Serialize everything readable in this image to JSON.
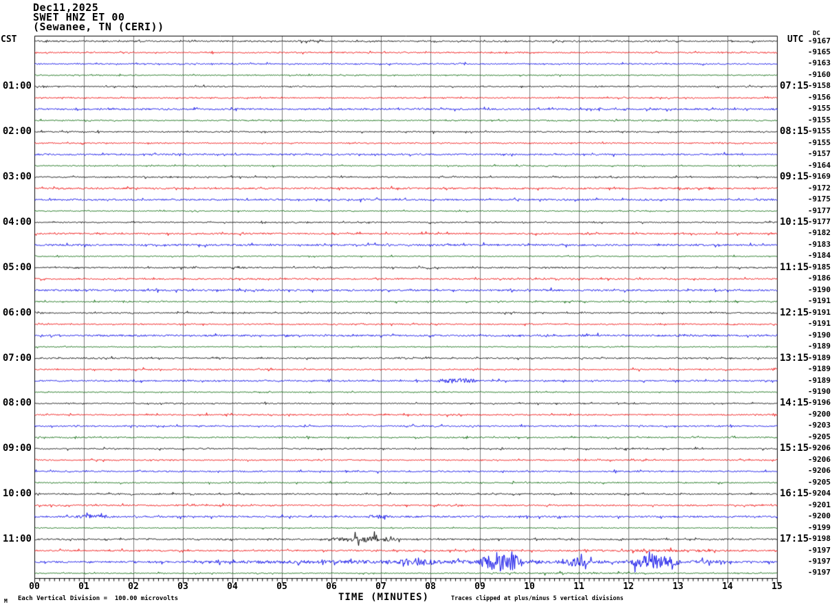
{
  "header": {
    "date": "Dec11,2025",
    "station": "SWET HNZ ET 00",
    "location": "(Sewanee, TN (CERI))"
  },
  "axes": {
    "left_header": "CST",
    "right_header": "UTC",
    "dc_header": "DC",
    "x_label": "TIME (MINUTES)",
    "x_ticks": [
      "00",
      "01",
      "02",
      "03",
      "04",
      "05",
      "06",
      "07",
      "08",
      "09",
      "10",
      "11",
      "12",
      "13",
      "14",
      "15"
    ]
  },
  "footer": {
    "watermark": "M",
    "scale_note": "Each Vertical Division =  100.00 microvolts",
    "clip_note": "Traces clipped at plus/minus 5 vertical divisions"
  },
  "colors": {
    "black": "#000000",
    "red": "#ee0000",
    "blue": "#0000e6",
    "green": "#006400",
    "grid": "#7a7a7a",
    "frame": "#000000"
  },
  "chart_data": {
    "type": "line",
    "subtype": "helicorder-seismogram",
    "title": "SWET HNZ ET 00 (Sewanee, TN (CERI)) Dec11,2025",
    "xlabel": "TIME (MINUTES)",
    "x_range_minutes": [
      0,
      15
    ],
    "x_major_tick_minutes": 1,
    "x_minor_tick_minutes": 0.1,
    "minutes_per_row": 15,
    "clip_divisions": 5,
    "microvolts_per_division": 100.0,
    "grid": "vertical-only",
    "noise_amp": {
      "black": 0.85,
      "red": 0.95,
      "blue": 1.05,
      "green": 0.7
    },
    "rows": [
      {
        "c": "black",
        "dc": -9167
      },
      {
        "c": "red",
        "dc": -9165
      },
      {
        "c": "blue",
        "dc": -9163
      },
      {
        "c": "green",
        "dc": -9160
      },
      {
        "c": "black",
        "dc": -9158,
        "cst": "01:00",
        "utc": "07:15"
      },
      {
        "c": "red",
        "dc": -9156
      },
      {
        "c": "blue",
        "dc": -9155
      },
      {
        "c": "green",
        "dc": -9155
      },
      {
        "c": "black",
        "dc": -9155,
        "cst": "02:00",
        "utc": "08:15"
      },
      {
        "c": "red",
        "dc": -9155
      },
      {
        "c": "blue",
        "dc": -9157
      },
      {
        "c": "green",
        "dc": -9164
      },
      {
        "c": "black",
        "dc": -9169,
        "cst": "03:00",
        "utc": "09:15"
      },
      {
        "c": "red",
        "dc": -9172
      },
      {
        "c": "blue",
        "dc": -9175
      },
      {
        "c": "green",
        "dc": -9177
      },
      {
        "c": "black",
        "dc": -9177,
        "cst": "04:00",
        "utc": "10:15"
      },
      {
        "c": "red",
        "dc": -9182
      },
      {
        "c": "blue",
        "dc": -9183
      },
      {
        "c": "green",
        "dc": -9184
      },
      {
        "c": "black",
        "dc": -9185,
        "cst": "05:00",
        "utc": "11:15"
      },
      {
        "c": "red",
        "dc": -9186
      },
      {
        "c": "blue",
        "dc": -9190
      },
      {
        "c": "green",
        "dc": -9191
      },
      {
        "c": "black",
        "dc": -9191,
        "cst": "06:00",
        "utc": "12:15"
      },
      {
        "c": "red",
        "dc": -9191
      },
      {
        "c": "blue",
        "dc": -9190
      },
      {
        "c": "green",
        "dc": -9189
      },
      {
        "c": "black",
        "dc": -9189,
        "cst": "07:00",
        "utc": "13:15"
      },
      {
        "c": "red",
        "dc": -9189
      },
      {
        "c": "blue",
        "dc": -9189
      },
      {
        "c": "green",
        "dc": -9190
      },
      {
        "c": "black",
        "dc": -9196,
        "cst": "08:00",
        "utc": "14:15"
      },
      {
        "c": "red",
        "dc": -9200
      },
      {
        "c": "blue",
        "dc": -9203
      },
      {
        "c": "green",
        "dc": -9205
      },
      {
        "c": "black",
        "dc": -9206,
        "cst": "09:00",
        "utc": "15:15"
      },
      {
        "c": "red",
        "dc": -9206
      },
      {
        "c": "blue",
        "dc": -9206
      },
      {
        "c": "green",
        "dc": -9205
      },
      {
        "c": "black",
        "dc": -9204,
        "cst": "10:00",
        "utc": "16:15"
      },
      {
        "c": "red",
        "dc": -9201
      },
      {
        "c": "blue",
        "dc": -9200
      },
      {
        "c": "green",
        "dc": -9199
      },
      {
        "c": "black",
        "dc": -9198,
        "cst": "11:00",
        "utc": "17:15"
      },
      {
        "c": "red",
        "dc": -9197
      },
      {
        "c": "blue",
        "dc": -9197
      },
      {
        "c": "green",
        "dc": -9197
      }
    ],
    "events": [
      {
        "row": 30,
        "start": 8.1,
        "end": 9.0,
        "amp": 3.2
      },
      {
        "row": 42,
        "start": 0.8,
        "end": 1.6,
        "amp": 2.0
      },
      {
        "row": 42,
        "start": 6.7,
        "end": 7.25,
        "amp": 1.6
      },
      {
        "row": 44,
        "start": 5.9,
        "end": 7.4,
        "amp": 3.0
      },
      {
        "row": 45,
        "start": 10.9,
        "end": 14.6,
        "amp": 0.6
      },
      {
        "row": 46,
        "start": 3.0,
        "end": 13.1,
        "amp": 1.4
      },
      {
        "row": 46,
        "start": 7.3,
        "end": 8.1,
        "amp": 3.5
      },
      {
        "row": 46,
        "start": 8.95,
        "end": 9.9,
        "amp": 12.0
      },
      {
        "row": 46,
        "start": 10.55,
        "end": 11.25,
        "amp": 5.0
      },
      {
        "row": 46,
        "start": 12.0,
        "end": 13.1,
        "amp": 8.5
      },
      {
        "row": 46,
        "start": 13.0,
        "end": 14.1,
        "amp": 1.2
      },
      {
        "row": 47,
        "start": 8.9,
        "end": 13.0,
        "amp": 0.5
      }
    ]
  }
}
